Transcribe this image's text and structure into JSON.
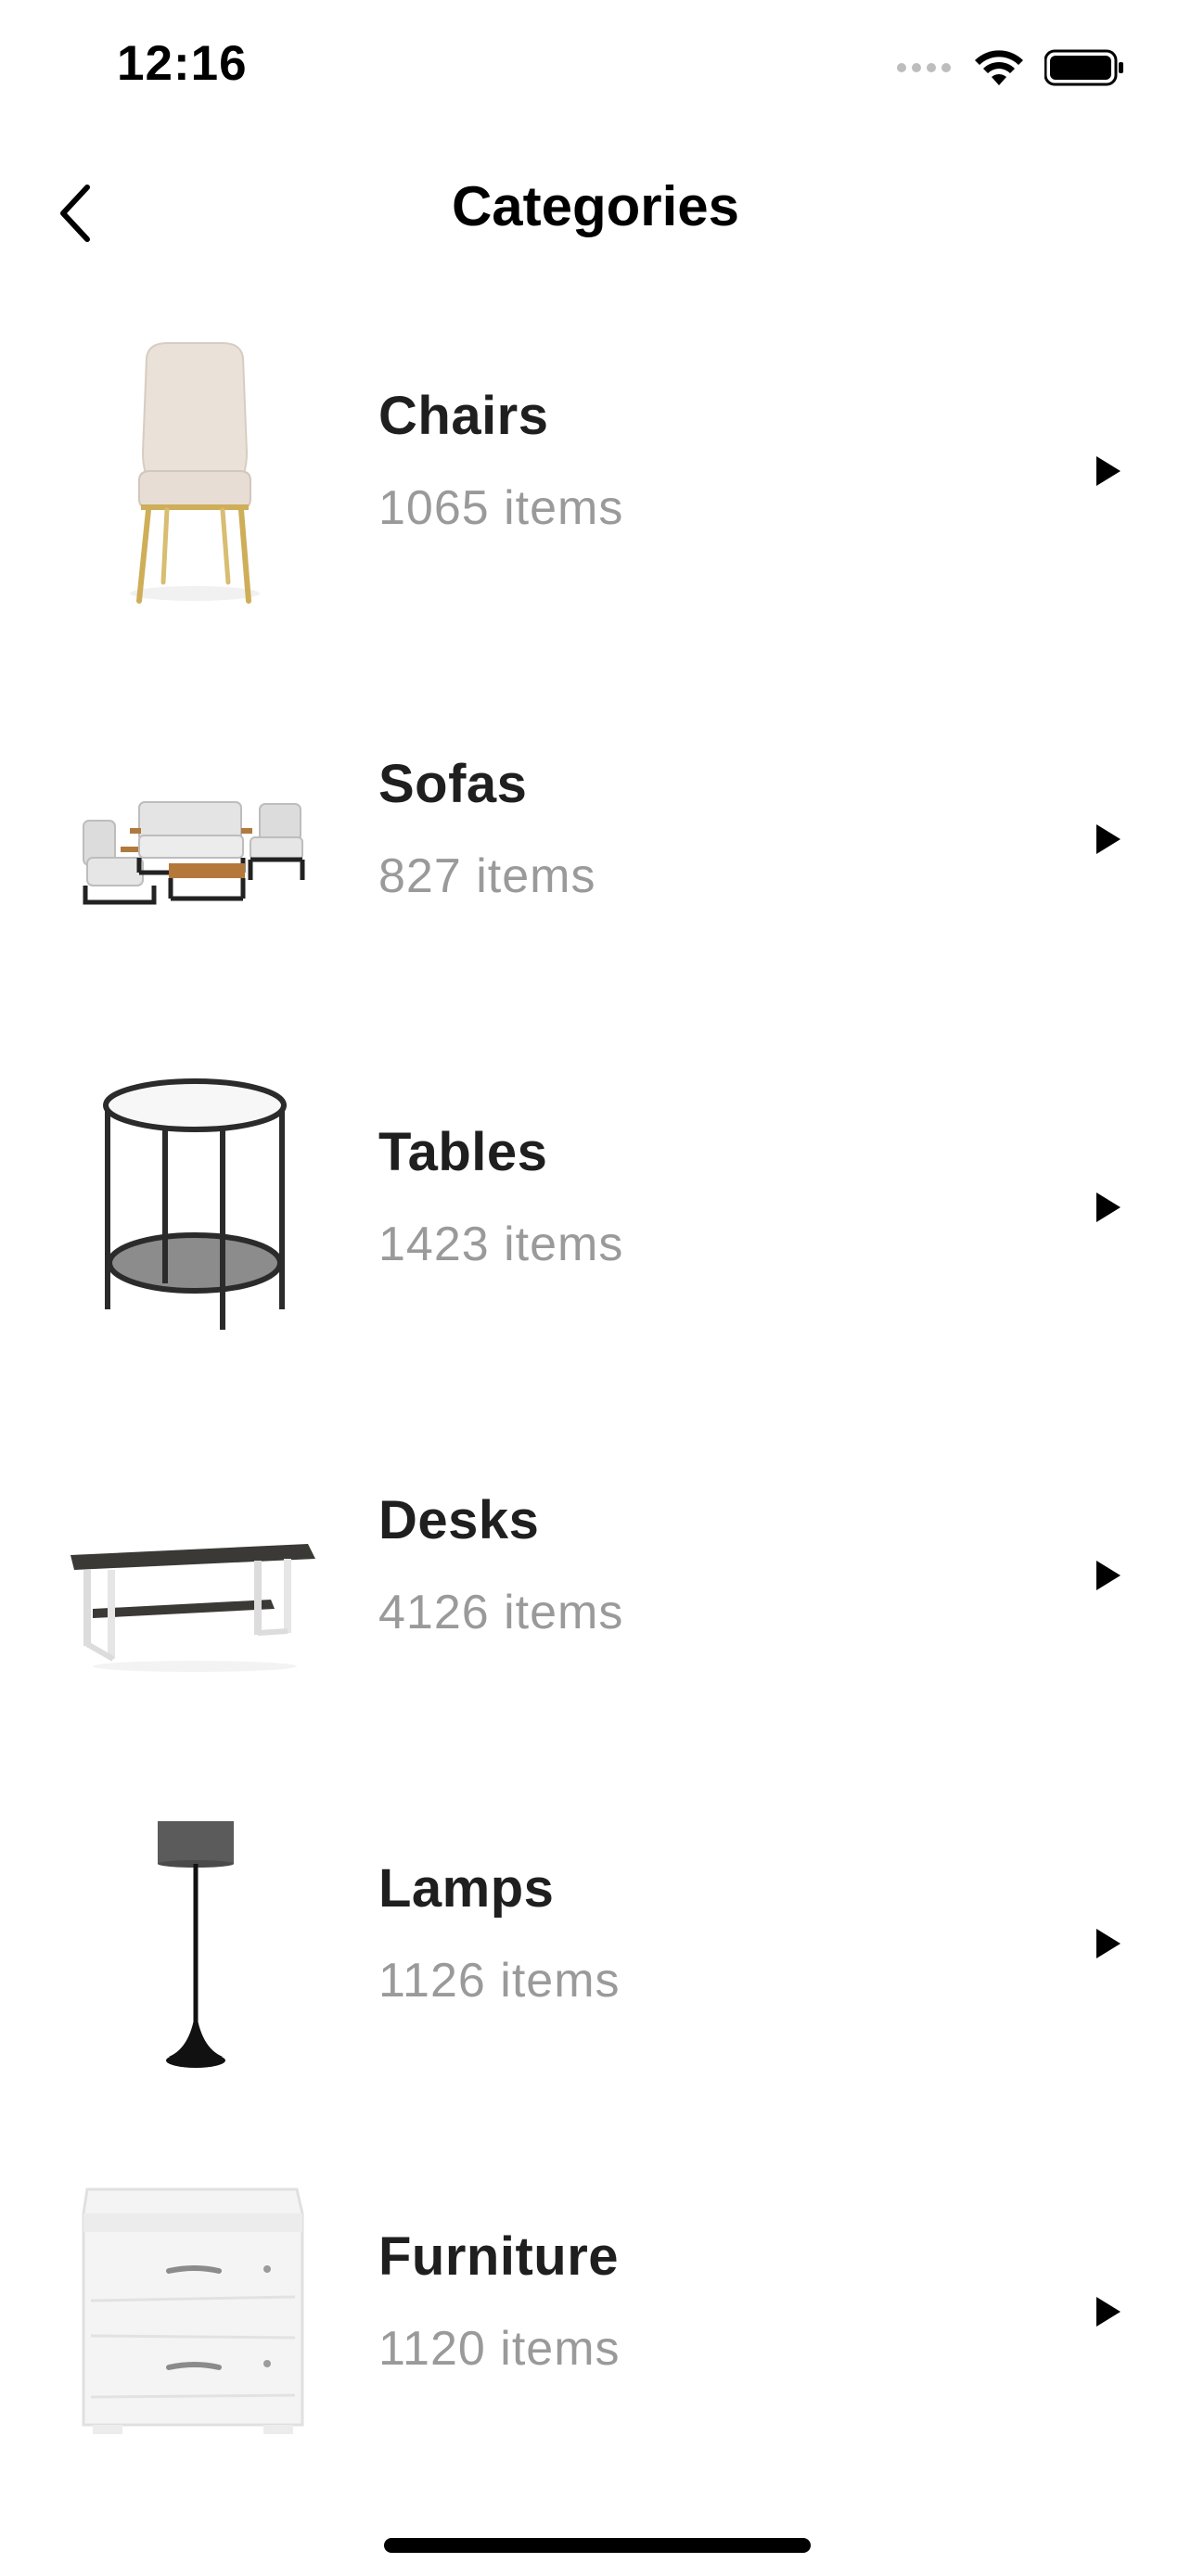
{
  "status_bar": {
    "time": "12:16"
  },
  "nav": {
    "title": "Categories"
  },
  "categories": [
    {
      "name": "Chairs",
      "count": "1065 items",
      "icon": "chair-icon"
    },
    {
      "name": "Sofas",
      "count": "827 items",
      "icon": "sofa-set-icon"
    },
    {
      "name": "Tables",
      "count": "1423 items",
      "icon": "side-table-icon"
    },
    {
      "name": "Desks",
      "count": "4126 items",
      "icon": "desk-icon"
    },
    {
      "name": "Lamps",
      "count": "1126 items",
      "icon": "floor-lamp-icon"
    },
    {
      "name": "Furniture",
      "count": "1120 items",
      "icon": "nightstand-icon"
    }
  ],
  "colors": {
    "title": "#1f1f1f",
    "count": "#9a9a9a",
    "background": "#ffffff"
  }
}
